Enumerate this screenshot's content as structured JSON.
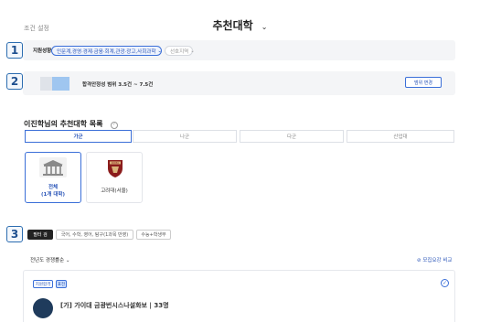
{
  "header": {
    "left_label": "조건 설정",
    "title": "추천대학"
  },
  "markers": [
    "1",
    "2",
    "3"
  ],
  "row1": {
    "label": "지원성향",
    "selected_pill": "인문계,경영·경제·금융·회계,관광·광고,사회과학",
    "secondary_pill": "선호지역"
  },
  "row2": {
    "text": "합격안정성 범위 3.5건 ~ 7.5건",
    "button": "범위 변경"
  },
  "list": {
    "title": "이진학님의 추천대학 목록",
    "tabs": [
      "가군",
      "나군",
      "다군",
      "산업대"
    ],
    "cards": [
      {
        "line1": "전체",
        "line2": "(1개 대학)"
      },
      {
        "line1": "고려대(서울)",
        "seal_text": "KOREA"
      }
    ]
  },
  "filters": {
    "btn1": "필터 검",
    "btn2": "국어, 수학, 영어, 탐구(1과목 반영)",
    "btn3": "수능+학생부"
  },
  "bottom": {
    "sort_label": "전년도 경쟁률순",
    "right_link": "모집요강 비교",
    "chip1": "지원합격",
    "chip2": "표전",
    "row_text": "[가] 가이대  금광번시스나설화보  | 33명"
  },
  "colors": {
    "accent": "#3b6fd8",
    "badge_border": "#2b6cb0",
    "seal_red": "#8b1c1c"
  }
}
